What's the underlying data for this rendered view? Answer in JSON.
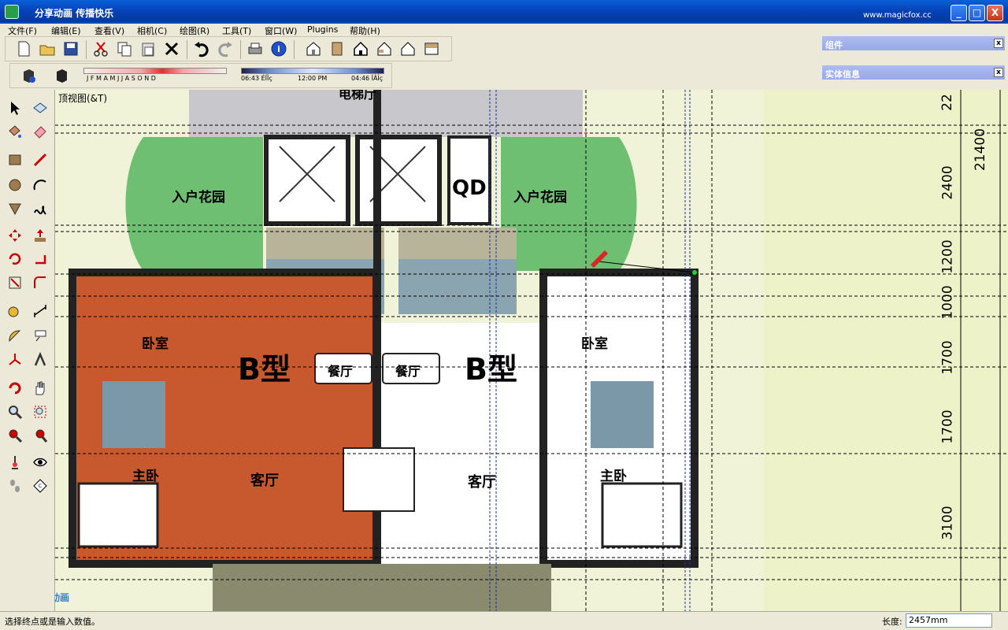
{
  "window": {
    "title": "分享动画  传播快乐",
    "brand": "www.magicfox.cc",
    "minimize": "_",
    "maximize": "□",
    "close": "X"
  },
  "menu": [
    "文件(F)",
    "编辑(E)",
    "查看(V)",
    "相机(C)",
    "绘图(R)",
    "工具(T)",
    "窗口(W)",
    "Plugins",
    "帮助(H)"
  ],
  "shadow": {
    "months": "J  F  M  A  M  J  J  A  S  O  N  D",
    "time_start": "06:43 ÉÏÎç",
    "time_mid": "12:00 PM",
    "time_end": "04:46 ÏÂÎç"
  },
  "panels": {
    "components": "组件",
    "entity_info": "实体信息",
    "close": "x"
  },
  "viewport": {
    "view_name": "顶视图(&T)",
    "room_labels": [
      "入户花园",
      "入户花园",
      "卧室",
      "卧室",
      "餐厅",
      "餐厅",
      "客厅",
      "客厅",
      "主卧",
      "主卧"
    ],
    "type_labels": [
      "B型",
      "B型"
    ],
    "top_label": "电梯厅",
    "qd": "QD",
    "dimensions": [
      "22",
      "2400",
      "21400",
      "1200",
      "1000",
      "1700",
      "1700",
      "3100"
    ],
    "watermark": "酷狐动画"
  },
  "status": {
    "hint": "选择终点或是输入数值。",
    "measure_label": "长度:",
    "measure_value": "2457mm"
  }
}
